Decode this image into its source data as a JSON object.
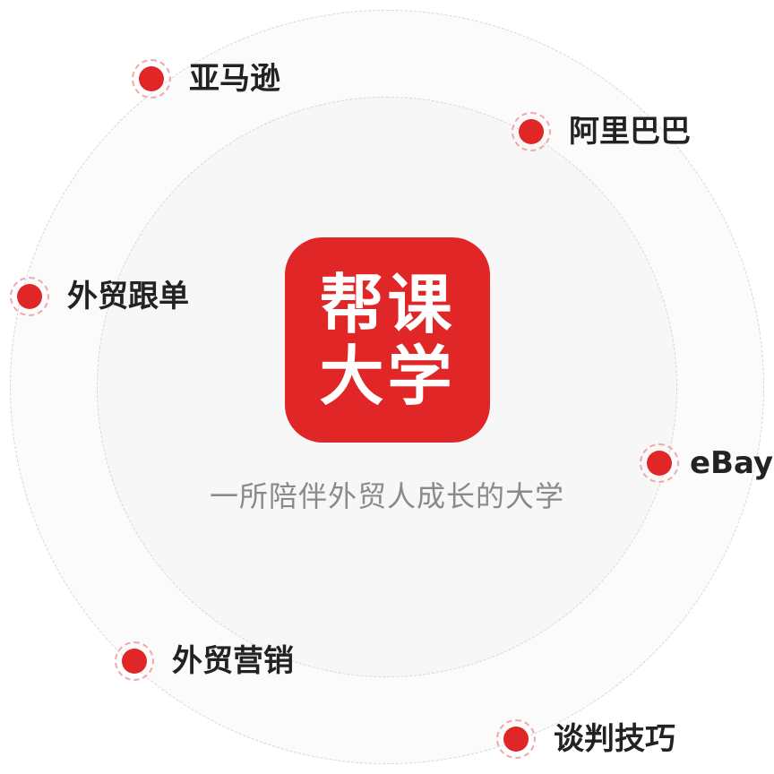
{
  "logo": {
    "line1": "帮课",
    "line2": "大学",
    "color": "#e02626"
  },
  "tagline": "一所陪伴外贸人成长的大学",
  "nodes": [
    {
      "label": "亚马逊"
    },
    {
      "label": "阿里巴巴"
    },
    {
      "label": "外贸跟单"
    },
    {
      "label": "eBay"
    },
    {
      "label": "外贸营销"
    },
    {
      "label": "谈判技巧"
    }
  ],
  "colors": {
    "accent": "#e02626",
    "ring_border": "#d6d6d6",
    "text": "#222222",
    "tagline": "#8a8a8a"
  }
}
